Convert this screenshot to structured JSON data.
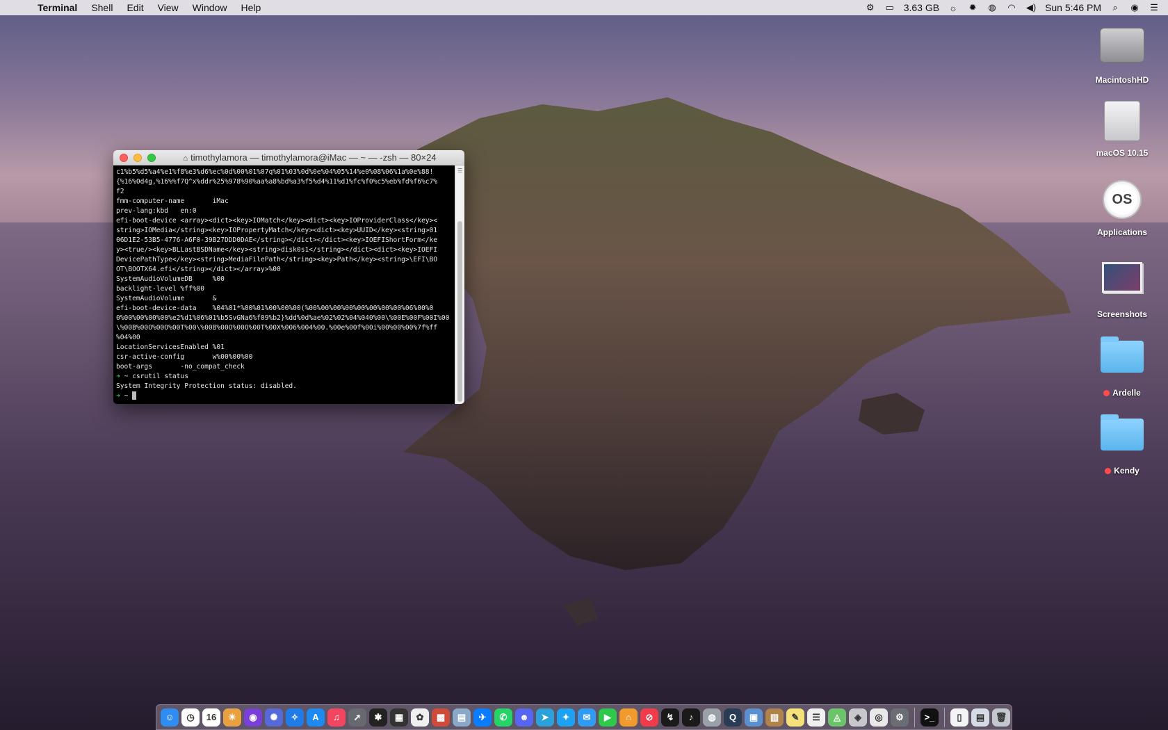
{
  "menubar": {
    "app_name": "Terminal",
    "menus": [
      "Shell",
      "Edit",
      "View",
      "Window",
      "Help"
    ],
    "memory": "3.63 GB",
    "clock": "Sun 5:46 PM"
  },
  "desktop_icons": [
    {
      "label": "MacintoshHD",
      "kind": "hard-drive-icon",
      "tagged": false
    },
    {
      "label": "macOS 10.15",
      "kind": "external-drive-icon",
      "tagged": false
    },
    {
      "label": "Applications",
      "kind": "macos-icon",
      "badge": "OS",
      "tagged": false
    },
    {
      "label": "Screenshots",
      "kind": "screenshot-folder-icon",
      "tagged": false
    },
    {
      "label": "Ardelle",
      "kind": "folder-icon",
      "tagged": true,
      "tag_color": "#ff4b4b"
    },
    {
      "label": "Kendy",
      "kind": "folder-icon",
      "tagged": true,
      "tag_color": "#ff4b4b"
    }
  ],
  "terminal": {
    "title": "timothylamora — timothylamora@iMac — ~ — -zsh — 80×24",
    "lines": [
      "c1%b5%d5%a4%e1%f8%e3%d6%ec%0d%00%01%07q%01%03%0d%0e%04%05%14%e0%08%06%1a%0e%88!",
      "{%16%0d4g,%16%%f7Q^x%ddr%25%978%90%aa%a8%bd%a3%f5%d4%11%d1%fc%f0%c5%eb%fd%f6%c7%",
      "f2",
      "fmm-computer-name       iMac",
      "prev-lang:kbd   en:0",
      "efi-boot-device <array><dict><key>IOMatch</key><dict><key>IOProviderClass</key><",
      "string>IOMedia</string><key>IOPropertyMatch</key><dict><key>UUID</key><string>01",
      "06D1E2-53B5-4776-A6F0-39B27DDD0DAE</string></dict></dict><key>IOEFIShortForm</ke",
      "y><true/><key>BLLastBSDName</key><string>disk0s1</string></dict><dict><key>IOEFI",
      "DevicePathType</key><string>MediaFilePath</string><key>Path</key><string>\\EFI\\BO",
      "OT\\BOOTX64.efi</string></dict></array>%00",
      "SystemAudioVolumeDB     %00",
      "backlight-level %ff%00",
      "SystemAudioVolume       &",
      "efi-boot-device-data    %04%01*%00%01%00%00%00(%00%00%00%00%00%00%00%00%06%00%0",
      "0%00%00%00%00%e2%d1%06%01%b5SvGNa6%f09%b2}%dd%0d%ae%02%02%04%040%00\\%00E%00F%00I%00",
      "\\%00B%00O%00O%00T%00\\%00B%00O%00O%00T%00X%006%004%00.%00e%00f%00i%00%00%00%7f%ff",
      "%04%00",
      "LocationServicesEnabled %01",
      "csr-active-config       w%00%00%00",
      "boot-args       -no_compat_check"
    ],
    "command_prompt": "~",
    "command": "csrutil status",
    "output": "System Integrity Protection status: disabled.",
    "current_prompt": "~"
  },
  "dock": {
    "items": [
      {
        "name": "finder",
        "color": "#2f8cf0",
        "glyph": "☺"
      },
      {
        "name": "clock",
        "color": "#ffffff",
        "glyph": "◷"
      },
      {
        "name": "calendar",
        "color": "#ffffff",
        "glyph": "16"
      },
      {
        "name": "photo-booth",
        "color": "#e8a040",
        "glyph": "☀"
      },
      {
        "name": "siri",
        "color": "#7a3fd8",
        "glyph": "◉"
      },
      {
        "name": "launchpad",
        "color": "#5569d8",
        "glyph": "✺"
      },
      {
        "name": "safari",
        "color": "#1e7be8",
        "glyph": "✧"
      },
      {
        "name": "app-store",
        "color": "#1c8af0",
        "glyph": "A"
      },
      {
        "name": "music",
        "color": "#f2455f",
        "glyph": "♫"
      },
      {
        "name": "rocket",
        "color": "#666a70",
        "glyph": "➚"
      },
      {
        "name": "activity",
        "color": "#222222",
        "glyph": "✱"
      },
      {
        "name": "mission-control",
        "color": "#333333",
        "glyph": "▦"
      },
      {
        "name": "photos",
        "color": "#f0f0f0",
        "glyph": "✿"
      },
      {
        "name": "photo-editor",
        "color": "#d04a3a",
        "glyph": "▩"
      },
      {
        "name": "preview",
        "color": "#8aa8c8",
        "glyph": "▤"
      },
      {
        "name": "messenger",
        "color": "#0a7cff",
        "glyph": "✈"
      },
      {
        "name": "whatsapp",
        "color": "#25d366",
        "glyph": "✆"
      },
      {
        "name": "discord",
        "color": "#5865f2",
        "glyph": "☻"
      },
      {
        "name": "telegram",
        "color": "#2aa1da",
        "glyph": "➤"
      },
      {
        "name": "twitter",
        "color": "#1da1f2",
        "glyph": "✦"
      },
      {
        "name": "messages",
        "color": "#2f9bf2",
        "glyph": "✉"
      },
      {
        "name": "facetime",
        "color": "#2ec84a",
        "glyph": "▶"
      },
      {
        "name": "home",
        "color": "#f29a2e",
        "glyph": "⌂"
      },
      {
        "name": "news",
        "color": "#f23b4a",
        "glyph": "⊘"
      },
      {
        "name": "stocks",
        "color": "#1a1a1a",
        "glyph": "↯"
      },
      {
        "name": "voice-memos",
        "color": "#1a1a1a",
        "glyph": "♪"
      },
      {
        "name": "disk-utility",
        "color": "#9aa0a8",
        "glyph": "◍"
      },
      {
        "name": "quicktime",
        "color": "#2a3b55",
        "glyph": "Q"
      },
      {
        "name": "preview-2",
        "color": "#5a8fd0",
        "glyph": "▣"
      },
      {
        "name": "notebook",
        "color": "#b0834a",
        "glyph": "▥"
      },
      {
        "name": "notes",
        "color": "#f6e07a",
        "glyph": "✎"
      },
      {
        "name": "reminders",
        "color": "#f0f0f0",
        "glyph": "☰"
      },
      {
        "name": "maps",
        "color": "#6bc36a",
        "glyph": "◬"
      },
      {
        "name": "installer",
        "color": "#c8c8cc",
        "glyph": "◈"
      },
      {
        "name": "macos-installer",
        "color": "#e8e8ea",
        "glyph": "◎"
      },
      {
        "name": "system-preferences",
        "color": "#6a6e74",
        "glyph": "⚙"
      },
      {
        "name": "terminal",
        "color": "#111111",
        "glyph": ">_"
      },
      {
        "name": "document",
        "color": "#f4f4f6",
        "glyph": "▯"
      },
      {
        "name": "downloads",
        "color": "#d6dce6",
        "glyph": "▤"
      },
      {
        "name": "trash",
        "color": "#c4c8ce",
        "glyph": "🗑"
      }
    ]
  }
}
